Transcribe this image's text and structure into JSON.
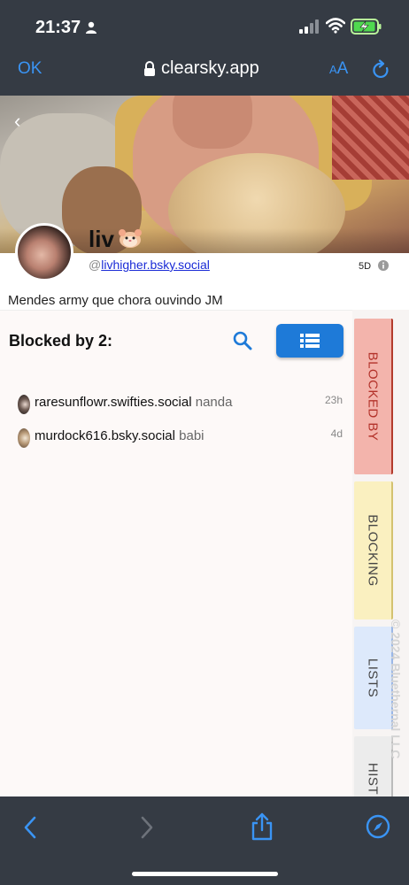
{
  "status_bar": {
    "time": "21:37"
  },
  "browser": {
    "ok_label": "OK",
    "url": "clearsky.app",
    "aa_small": "A",
    "aa_large": "A"
  },
  "profile": {
    "display_name": "liv",
    "handle_prefix": "@",
    "handle": "livhigher.bsky.social",
    "age": "5D",
    "bio": "Mendes army que chora ouvindo JM"
  },
  "blocked": {
    "heading": "Blocked by 2:",
    "rows": [
      {
        "handle": "raresunflowr.swifties.social",
        "name": "nanda",
        "time": "23h"
      },
      {
        "handle": "murdock616.bsky.social",
        "name": "babi",
        "time": "4d"
      }
    ]
  },
  "tabs": {
    "blocked_by": "BLOCKED BY",
    "blocking": "BLOCKING",
    "lists": "LISTS",
    "history": "HIST"
  },
  "copyright": "© 2024 Bluethernal LLC",
  "colors": {
    "accent": "#1e7ad8",
    "safari_blue": "#3a94f4",
    "chrome": "#353b44"
  }
}
